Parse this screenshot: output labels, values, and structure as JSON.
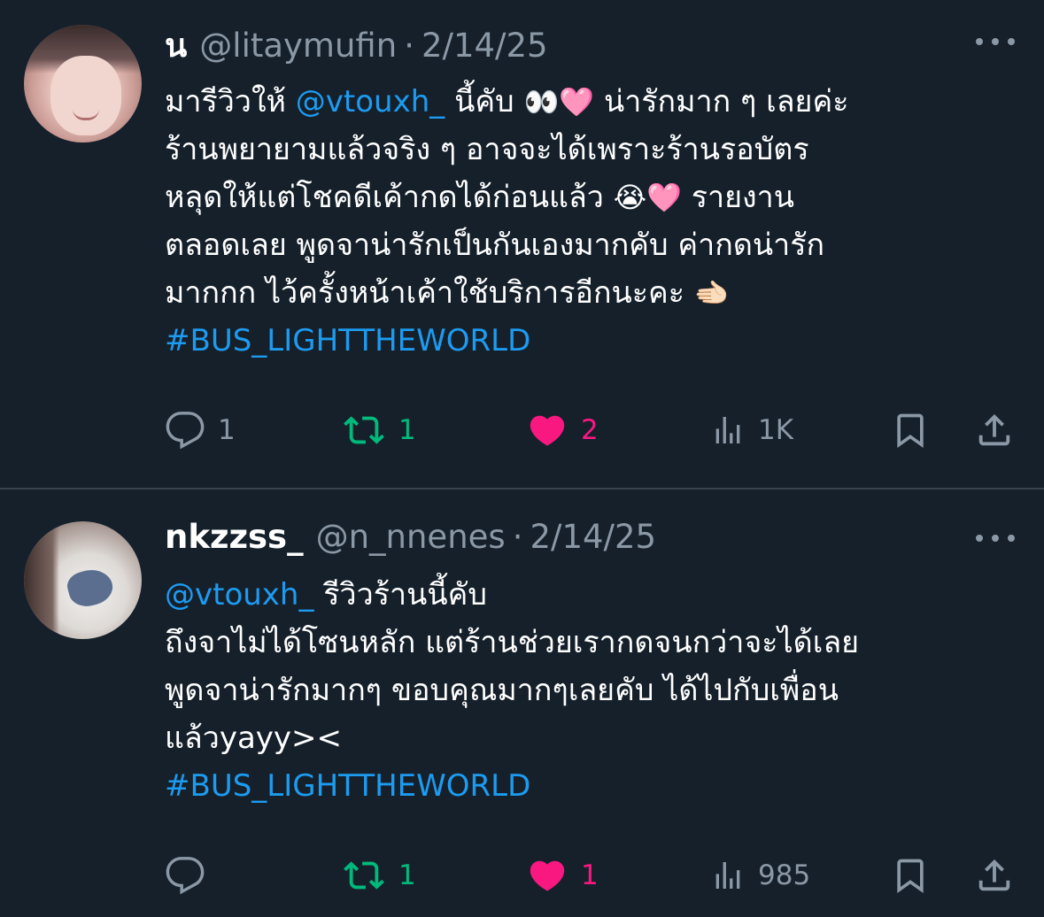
{
  "tweets": [
    {
      "name": "น",
      "handle": "@litaymufin",
      "separator": "·",
      "date": "2/14/25",
      "lines": [
        [
          "มารีวิวให้ ",
          "@vtouxh_",
          " นี้คับ ",
          "👀🩷",
          " น่ารักมาก ๆ เลยค่ะ"
        ],
        [
          "ร้านพยายามแล้วจริง ๆ อาจจะได้เพราะร้านรอบัตร"
        ],
        [
          "หลุดให้แต่โชคดีเค้ากดได้ก่อนแล้ว ",
          "😭🩷",
          " รายงาน"
        ],
        [
          "ตลอดเลย พูดจาน่ารักเป็นกันเองมากคับ ค่ากดน่ารัก"
        ],
        [
          "มากกก ไว้ครั้งหน้าเค้าใช้บริการอีกนะคะ ",
          "🫲🏻"
        ]
      ],
      "mention": "@vtouxh_",
      "hashtag": " #BUS_LIGHTTHEWORLD",
      "reply_count": "1",
      "retweet_count": "1",
      "like_count": "2",
      "view_count": "1K",
      "icons": [
        "reply-icon",
        "retweet-icon",
        "heart-icon",
        "views-icon",
        "bookmark-icon",
        "share-icon"
      ],
      "colors": {
        "retweet": "#00ba7c",
        "like": "#f91880",
        "link": "#1d9bf0",
        "muted": "#8b98a5",
        "background": "#15202b"
      }
    },
    {
      "name": "nkzzss_",
      "handle": "@n_nnenes",
      "separator": "·",
      "date": "2/14/25",
      "line1_mention": "@vtouxh_",
      "line1_text": " รีวิวร้านนี้คับ",
      "line2": "ถึงจาไม่ได้โซนหลัก แต่ร้านช่วยเรากดจนกว่าจะได้เลย",
      "line3": "พูดจาน่ารักมากๆ ขอบคุณมากๆเลยคับ ได้ไปกับเพื่อน",
      "line4": "แล้วyayy><",
      "hashtag": "#BUS_LIGHTTHEWORLD",
      "reply_count": "",
      "retweet_count": "1",
      "like_count": "1",
      "view_count": "985"
    }
  ]
}
